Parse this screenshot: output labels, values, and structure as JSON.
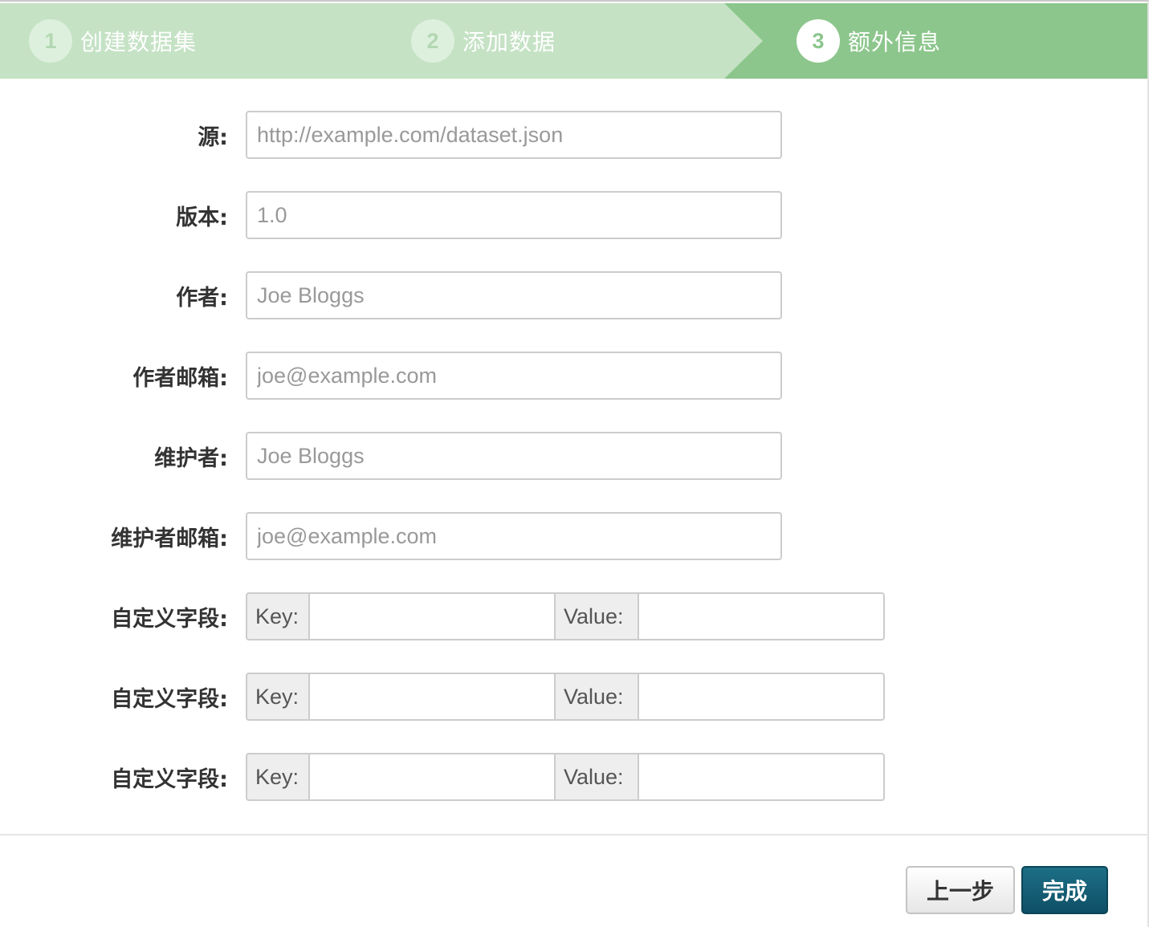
{
  "stages": [
    {
      "number": "1",
      "title": "创建数据集",
      "state": "done"
    },
    {
      "number": "2",
      "title": "添加数据",
      "state": "done"
    },
    {
      "number": "3",
      "title": "额外信息",
      "state": "active"
    }
  ],
  "fields": {
    "source": {
      "label": "源:",
      "value": "",
      "placeholder": "http://example.com/dataset.json"
    },
    "version": {
      "label": "版本:",
      "value": "",
      "placeholder": "1.0"
    },
    "author": {
      "label": "作者:",
      "value": "",
      "placeholder": "Joe Bloggs"
    },
    "author_email": {
      "label": "作者邮箱:",
      "value": "",
      "placeholder": "joe@example.com"
    },
    "maintainer": {
      "label": "维护者:",
      "value": "",
      "placeholder": "Joe Bloggs"
    },
    "maintainer_email": {
      "label": "维护者邮箱:",
      "value": "",
      "placeholder": "joe@example.com"
    }
  },
  "custom_fields": [
    {
      "label": "自定义字段:",
      "key_addon": "Key:",
      "value_addon": "Value:",
      "key": "",
      "value": ""
    },
    {
      "label": "自定义字段:",
      "key_addon": "Key:",
      "value_addon": "Value:",
      "key": "",
      "value": ""
    },
    {
      "label": "自定义字段:",
      "key_addon": "Key:",
      "value_addon": "Value:",
      "key": "",
      "value": ""
    }
  ],
  "buttons": {
    "previous": "上一步",
    "finish": "完成"
  },
  "colors": {
    "stage_done_bg": "#c5e2c5",
    "stage_active_bg": "#8cc68c",
    "primary_button": "#15607a"
  }
}
